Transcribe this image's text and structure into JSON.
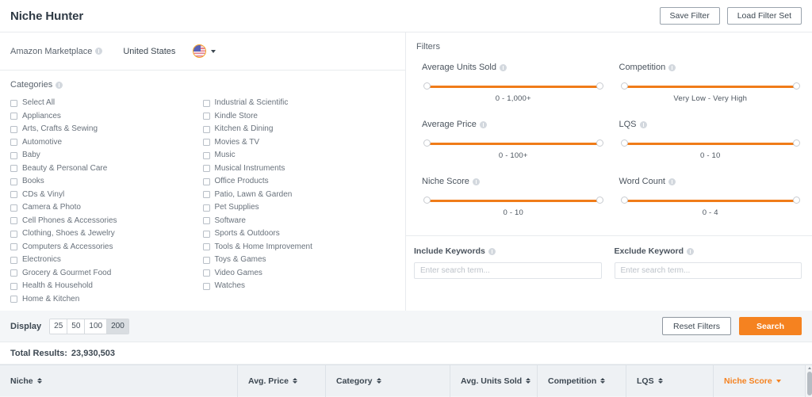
{
  "header": {
    "title": "Niche Hunter",
    "save_filter_label": "Save Filter",
    "load_filter_label": "Load Filter Set"
  },
  "marketplace": {
    "label": "Amazon Marketplace",
    "value": "United States",
    "flag_icon": "us-flag-icon"
  },
  "categories": {
    "label": "Categories",
    "column_one": [
      "Select All",
      "Appliances",
      "Arts, Crafts & Sewing",
      "Automotive",
      "Baby",
      "Beauty & Personal Care",
      "Books",
      "CDs & Vinyl",
      "Camera & Photo",
      "Cell Phones & Accessories",
      "Clothing, Shoes & Jewelry",
      "Computers & Accessories",
      "Electronics",
      "Grocery & Gourmet Food",
      "Health & Household",
      "Home & Kitchen"
    ],
    "column_two": [
      "Industrial & Scientific",
      "Kindle Store",
      "Kitchen & Dining",
      "Movies & TV",
      "Music",
      "Musical Instruments",
      "Office Products",
      "Patio, Lawn & Garden",
      "Pet Supplies",
      "Software",
      "Sports & Outdoors",
      "Tools & Home Improvement",
      "Toys & Games",
      "Video Games",
      "Watches"
    ]
  },
  "filters": {
    "title": "Filters",
    "sliders": [
      {
        "label": "Average Units Sold",
        "range": "0  -  1,000+"
      },
      {
        "label": "Competition",
        "range": "Very Low  -  Very High"
      },
      {
        "label": "Average Price",
        "range": "0  -  100+"
      },
      {
        "label": "LQS",
        "range": "0  -  10"
      },
      {
        "label": "Niche Score",
        "range": "0  -  10"
      },
      {
        "label": "Word Count",
        "range": "0  -  4"
      }
    ],
    "include_keywords": {
      "label": "Include Keywords",
      "placeholder": "Enter search term...",
      "value": ""
    },
    "exclude_keyword": {
      "label": "Exclude Keyword",
      "placeholder": "Enter search term...",
      "value": ""
    }
  },
  "display": {
    "label": "Display",
    "options": [
      "25",
      "50",
      "100",
      "200"
    ],
    "selected": "200",
    "reset_label": "Reset Filters",
    "search_label": "Search"
  },
  "results": {
    "total_label": "Total Results:",
    "total_value": "23,930,503",
    "columns": [
      "Niche",
      "Avg. Price",
      "Category",
      "Avg. Units Sold",
      "Competition",
      "LQS",
      "Niche Score"
    ],
    "sorted_column": "Niche Score",
    "sort_direction": "desc"
  },
  "colors": {
    "accent": "#f58220",
    "slider_track": "#f07c19",
    "header_bg": "#eef1f4",
    "page_bg": "#f4f6f8"
  }
}
